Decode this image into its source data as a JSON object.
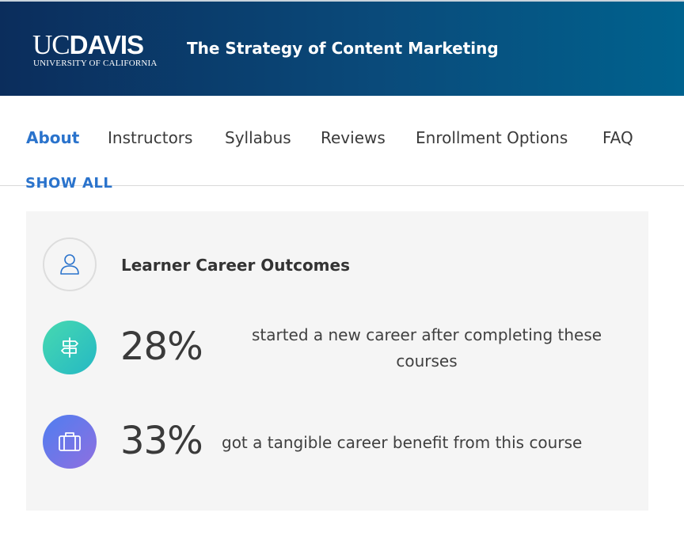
{
  "header": {
    "logo_main_uc": "UC",
    "logo_main_davis": "DAVIS",
    "logo_sub": "UNIVERSITY OF CALIFORNIA",
    "course_title": "The Strategy of Content Marketing"
  },
  "nav": {
    "items": [
      {
        "label": "About",
        "active": true
      },
      {
        "label": "Instructors"
      },
      {
        "label": "Syllabus"
      },
      {
        "label": "Reviews"
      },
      {
        "label": "Enrollment Options"
      },
      {
        "label": "FAQ"
      }
    ]
  },
  "show_all": "SHOW ALL",
  "outcomes": {
    "title": "Learner Career Outcomes",
    "title_icon": "person-icon",
    "stats": [
      {
        "value": "28%",
        "text": "started a new career after completing these courses",
        "icon": "signpost-icon",
        "color": "#36c6ba"
      },
      {
        "value": "33%",
        "text": "got a tangible career benefit from this course",
        "icon": "briefcase-icon",
        "color": "#6d78e8"
      }
    ]
  },
  "colors": {
    "header_dark": "#0b2d5c",
    "header_light": "#00628e",
    "accent": "#2a73cc",
    "card_bg": "#f5f5f5"
  }
}
